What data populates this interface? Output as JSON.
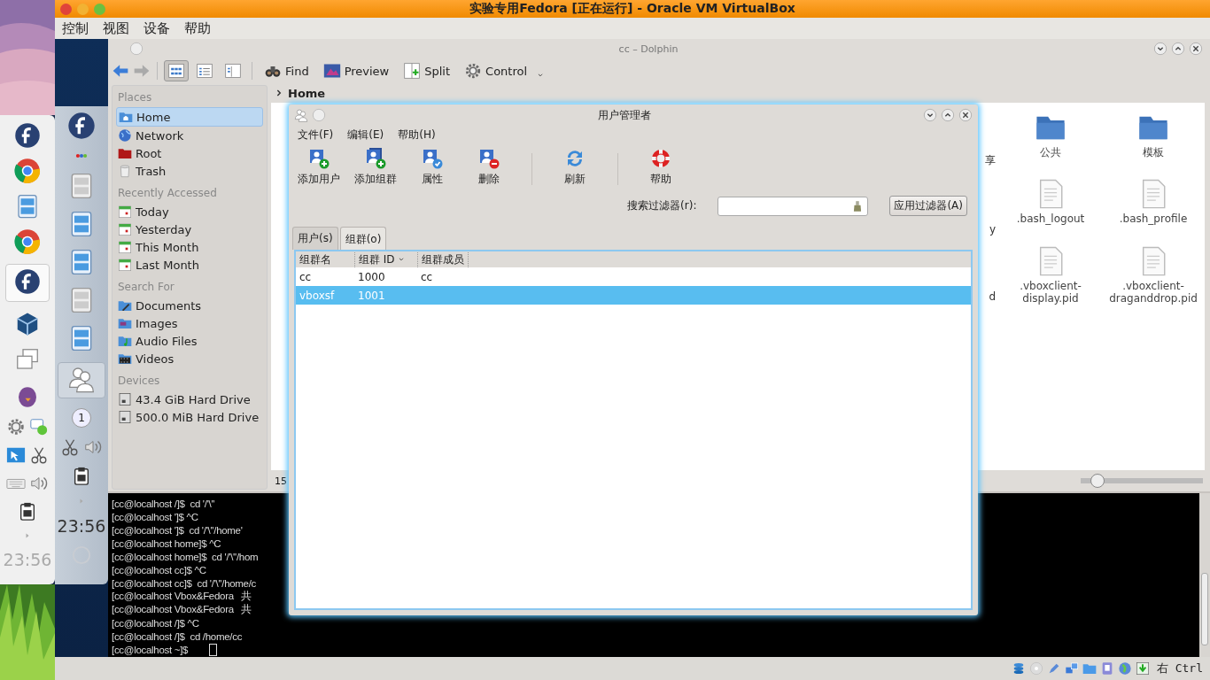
{
  "vbox": {
    "title": "实验专用Fedora [正在运行] - Oracle VM VirtualBox",
    "menu": [
      "控制",
      "视图",
      "设备",
      "帮助"
    ],
    "host_key": "右 Ctrl"
  },
  "host_panel": {
    "clock": "23:56"
  },
  "guest_panel": {
    "pager": "1",
    "clock": "23:56"
  },
  "dolphin": {
    "title": "cc – Dolphin",
    "view_modes": [
      {
        "selected": true
      },
      {
        "selected": false
      },
      {
        "selected": false
      }
    ],
    "toolbar": [
      "Find",
      "Preview",
      "Split",
      "Control"
    ],
    "breadcrumb": "Home",
    "places": [
      {
        "heading": "Places",
        "items": [
          {
            "label": "Home",
            "selected": true
          },
          {
            "label": "Network",
            "selected": false
          },
          {
            "label": "Root",
            "selected": false
          },
          {
            "label": "Trash",
            "selected": false
          }
        ]
      },
      {
        "heading": "Recently Accessed",
        "items": [
          {
            "label": "Today",
            "selected": false
          },
          {
            "label": "Yesterday",
            "selected": false
          },
          {
            "label": "This Month",
            "selected": false
          },
          {
            "label": "Last Month",
            "selected": false
          }
        ]
      },
      {
        "heading": "Search For",
        "items": [
          {
            "label": "Documents",
            "selected": false
          },
          {
            "label": "Images",
            "selected": false
          },
          {
            "label": "Audio Files",
            "selected": false
          },
          {
            "label": "Videos",
            "selected": false
          }
        ]
      },
      {
        "heading": "Devices",
        "items": [
          {
            "label": "43.4 GiB Hard Drive",
            "selected": false
          },
          {
            "label": "500.0 MiB Hard Drive",
            "selected": false
          }
        ]
      }
    ],
    "file_rows": [
      {
        "cut": "享",
        "files": [
          {
            "kind": "folder",
            "name": "公共"
          },
          {
            "kind": "folder",
            "name": "模板"
          }
        ]
      },
      {
        "cut": "y",
        "files": [
          {
            "kind": "text",
            "name": ".bash_logout"
          },
          {
            "kind": "text",
            "name": ".bash_profile"
          }
        ]
      },
      {
        "cut": "d",
        "files": [
          {
            "kind": "text",
            "name": ".vboxclient-display.pid"
          },
          {
            "kind": "text",
            "name": ".vboxclient-draganddrop.pid"
          }
        ]
      }
    ],
    "status": "15",
    "zoom": {
      "level": 0.14
    }
  },
  "terminal": {
    "lines": [
      "[cc@localhost /]$  cd '/'\\''",
      "[cc@localhost ']$ ^C",
      "[cc@localhost ']$  cd '/'\\''/home'",
      "[cc@localhost home]$ ^C",
      "[cc@localhost home]$  cd '/'\\''/hom",
      "[cc@localhost cc]$ ^C",
      "[cc@localhost cc]$  cd '/'\\''/home/c",
      "[cc@localhost Vbox&Fedora   共",
      "[cc@localhost Vbox&Fedora   共",
      "[cc@localhost /]$ ^C",
      "[cc@localhost /]$  cd /home/cc",
      "[cc@localhost ~]$"
    ]
  },
  "dialog": {
    "title": "用户管理者",
    "menu": [
      "文件(F)",
      "编辑(E)",
      "帮助(H)"
    ],
    "toolbar": [
      {
        "kind": "add_user",
        "label": "添加用户"
      },
      {
        "kind": "add_group",
        "label": "添加组群"
      },
      {
        "kind": "properties",
        "label": "属性"
      },
      {
        "kind": "delete",
        "label": "删除"
      },
      {
        "kind": "refresh",
        "label": "刷新"
      },
      {
        "kind": "help",
        "label": "帮助"
      }
    ],
    "filter_label": "搜索过滤器(r):",
    "apply_button": "应用过滤器(A)",
    "tabs": [
      {
        "label": "用户(s)",
        "selected": false
      },
      {
        "label": "组群(o)",
        "selected": true
      }
    ],
    "columns": [
      {
        "label": "组群名",
        "sorted": false
      },
      {
        "label": "组群 ID",
        "sorted": true
      },
      {
        "label": "组群成员",
        "sorted": false
      }
    ],
    "rows": [
      {
        "cells": [
          "cc",
          "1000",
          "cc"
        ],
        "selected": false
      },
      {
        "cells": [
          "vboxsf",
          "1001"
        ],
        "selected": true
      }
    ]
  }
}
